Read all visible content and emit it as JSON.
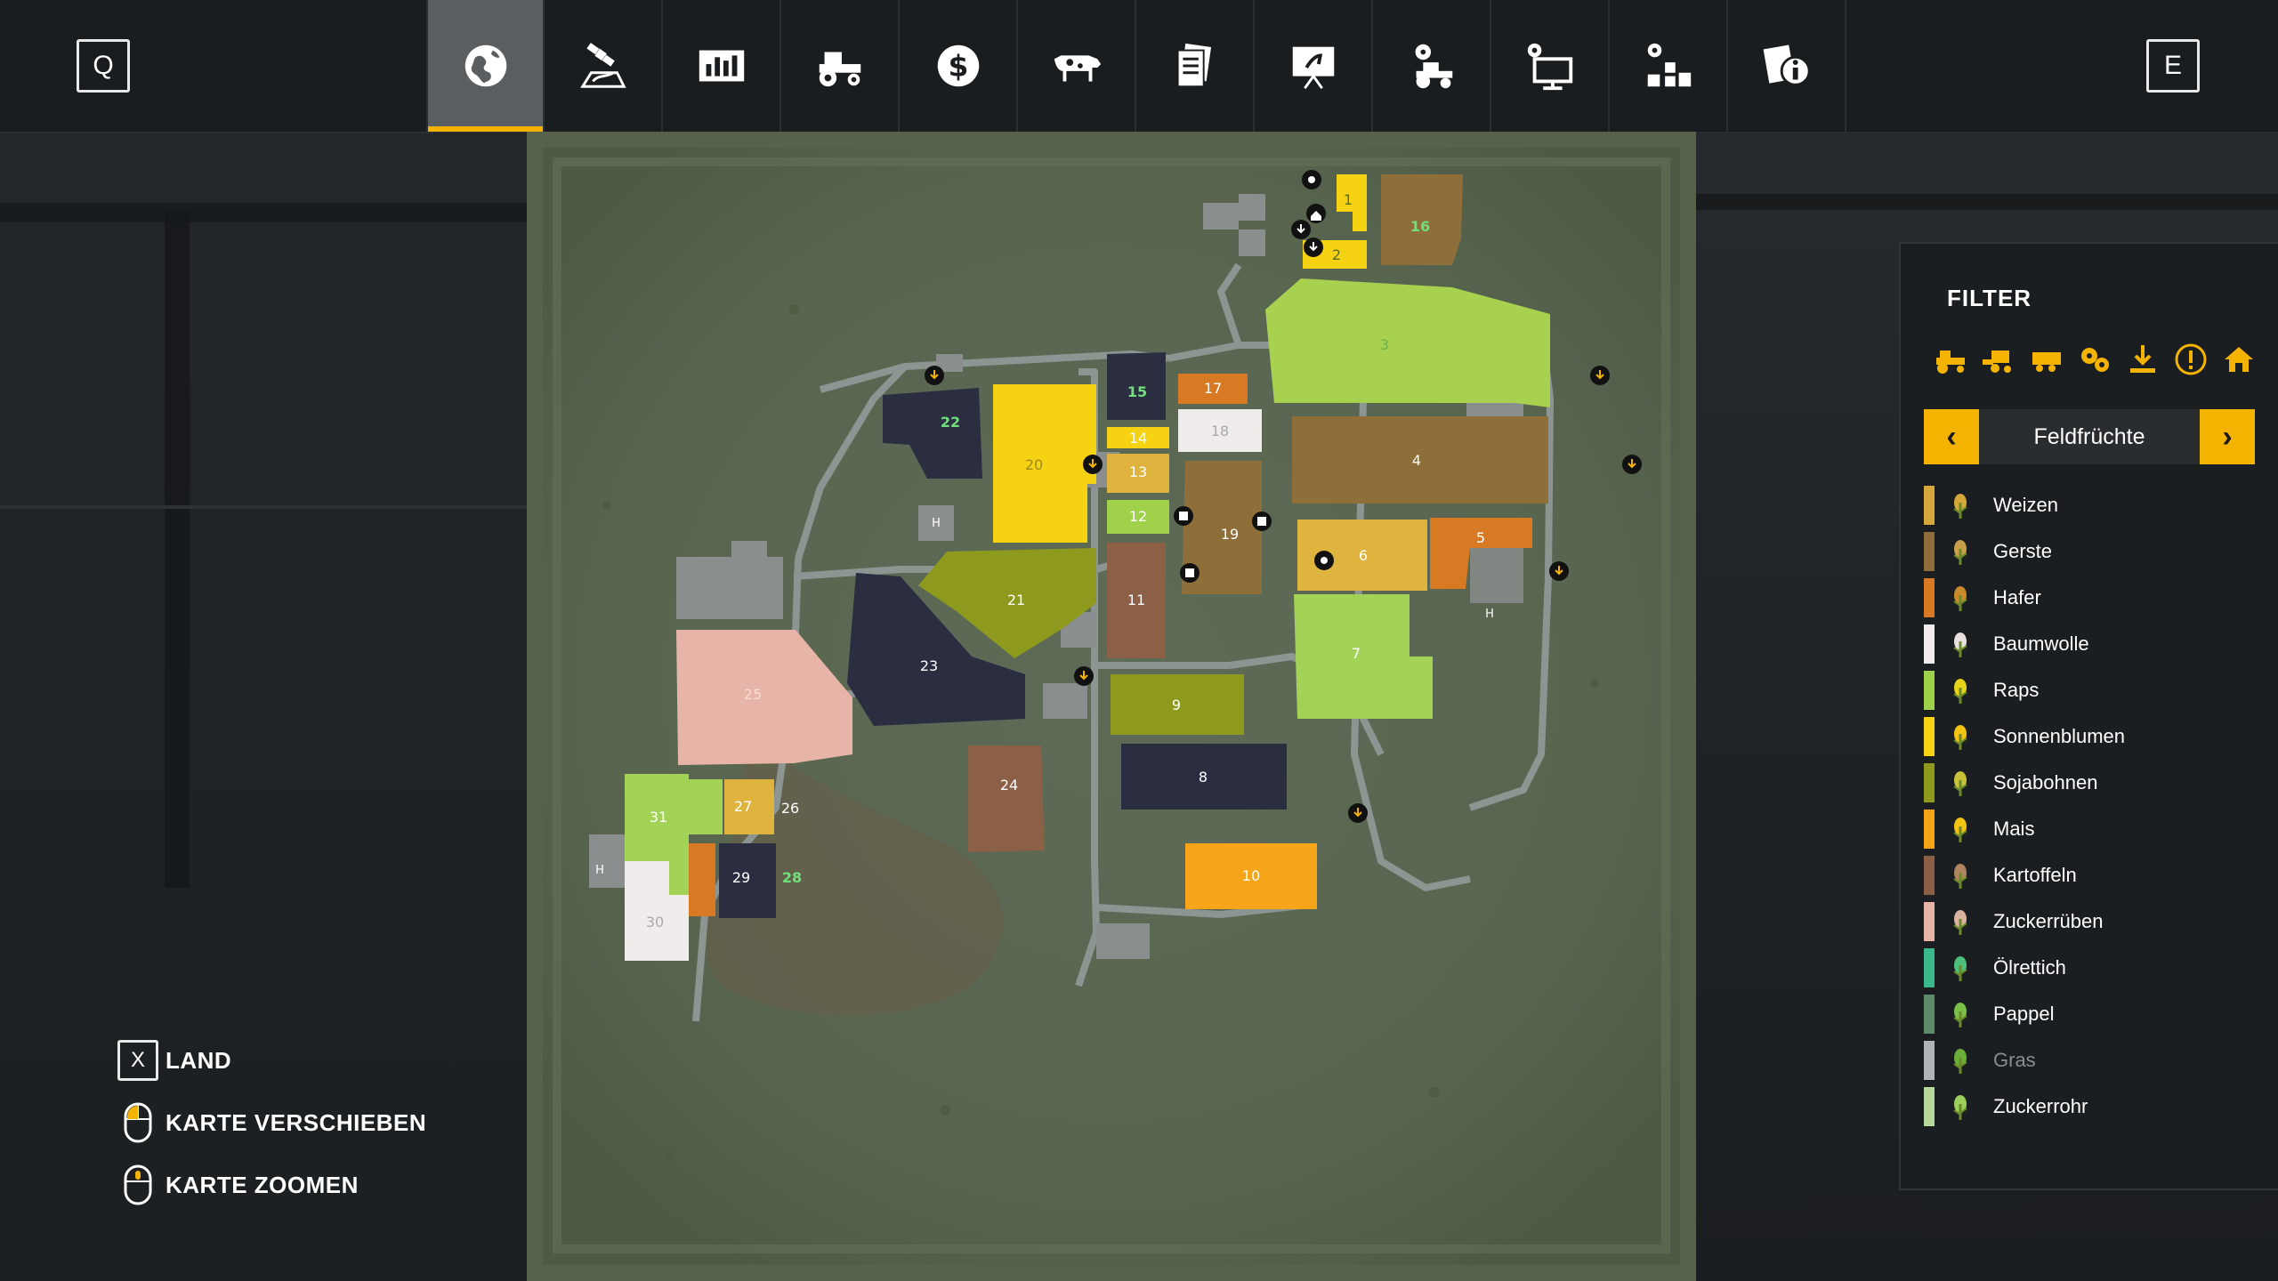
{
  "topbar": {
    "left_key": "Q",
    "right_key": "E",
    "tabs": [
      {
        "icon": "globe-icon",
        "active": true
      },
      {
        "icon": "satellite-map-icon",
        "active": false
      },
      {
        "icon": "statistics-chart-icon",
        "active": false
      },
      {
        "icon": "tractor-icon",
        "active": false
      },
      {
        "icon": "dollar-icon",
        "active": false
      },
      {
        "icon": "cow-icon",
        "active": false
      },
      {
        "icon": "contracts-icon",
        "active": false
      },
      {
        "icon": "help-board-icon",
        "active": false
      },
      {
        "icon": "vehicle-settings-icon",
        "active": false
      },
      {
        "icon": "display-settings-icon",
        "active": false
      },
      {
        "icon": "general-settings-icon",
        "active": false
      },
      {
        "icon": "info-icon",
        "active": false
      }
    ],
    "accent_color": "#f5b301"
  },
  "map": {
    "field_numbers": [
      "1",
      "2",
      "3",
      "4",
      "5",
      "6",
      "7",
      "8",
      "9",
      "10",
      "11",
      "12",
      "13",
      "14",
      "15",
      "16",
      "17",
      "18",
      "19",
      "20",
      "21",
      "22",
      "23",
      "24",
      "25",
      "26",
      "27",
      "28",
      "29",
      "30",
      "31"
    ],
    "building_marker": "H"
  },
  "filter": {
    "title": "FILTER",
    "icons": [
      "tractor-filter-icon",
      "harvester-filter-icon",
      "trailer-filter-icon",
      "tools-filter-icon",
      "sell-point-filter-icon",
      "warning-filter-icon",
      "farm-house-filter-icon"
    ],
    "selector_label": "Feldfrüchte",
    "crops": [
      {
        "label": "Weizen",
        "color": "#d6a83b",
        "icon": "wheat-icon",
        "dim": false
      },
      {
        "label": "Gerste",
        "color": "#8e6f3a",
        "icon": "barley-icon",
        "dim": false
      },
      {
        "label": "Hafer",
        "color": "#d77a23",
        "icon": "oat-icon",
        "dim": false
      },
      {
        "label": "Baumwolle",
        "color": "#f1ecec",
        "icon": "cotton-icon",
        "dim": false
      },
      {
        "label": "Raps",
        "color": "#9fd14a",
        "icon": "canola-icon",
        "dim": false
      },
      {
        "label": "Sonnenblumen",
        "color": "#f5d313",
        "icon": "sunflower-icon",
        "dim": false
      },
      {
        "label": "Sojabohnen",
        "color": "#8d9a1e",
        "icon": "soybean-icon",
        "dim": false
      },
      {
        "label": "Mais",
        "color": "#f5a517",
        "icon": "corn-icon",
        "dim": false
      },
      {
        "label": "Kartoffeln",
        "color": "#8c5f47",
        "icon": "potato-icon",
        "dim": false
      },
      {
        "label": "Zuckerrüben",
        "color": "#e7b5a7",
        "icon": "sugarbeet-icon",
        "dim": false
      },
      {
        "label": "Ölrettich",
        "color": "#3bb98a",
        "icon": "oilradish-icon",
        "dim": false
      },
      {
        "label": "Pappel",
        "color": "#5e8a6c",
        "icon": "poplar-icon",
        "dim": false
      },
      {
        "label": "Gras",
        "color": "#aeb3b3",
        "icon": "grass-icon",
        "dim": true
      },
      {
        "label": "Zuckerrohr",
        "color": "#b7d89a",
        "icon": "sugarcane-icon",
        "dim": false
      }
    ]
  },
  "controls": [
    {
      "key": "X",
      "label": "LAND",
      "icon": "keyboard-key-icon"
    },
    {
      "key": "",
      "label": "KARTE VERSCHIEBEN",
      "icon": "mouse-drag-icon"
    },
    {
      "key": "",
      "label": "KARTE ZOOMEN",
      "icon": "mouse-wheel-icon"
    }
  ]
}
